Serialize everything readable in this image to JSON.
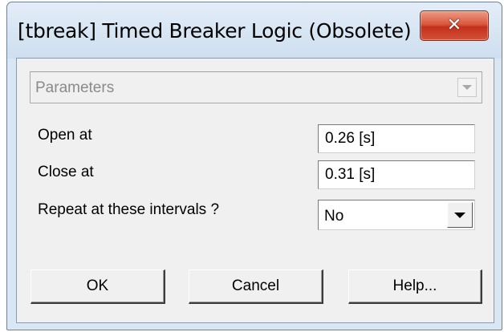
{
  "window": {
    "title": "[tbreak] Timed Breaker Logic (Obsolete)",
    "close_icon": "x-icon",
    "close_glyph": "✕"
  },
  "group_selector": {
    "value": "Parameters",
    "icon": "chevron-down-icon"
  },
  "params": {
    "open_at": {
      "label": "Open at",
      "value": "0.26 [s]"
    },
    "close_at": {
      "label": "Close at",
      "value": "0.31 [s]"
    },
    "repeat": {
      "label": "Repeat at these intervals ?",
      "value": "No",
      "icon": "dropdown-arrow-icon"
    }
  },
  "buttons": {
    "ok": "OK",
    "cancel": "Cancel",
    "help": "Help..."
  },
  "colors": {
    "title_bar": "#d7e5f3",
    "close_button": "#c4301a",
    "client_background": "#f0f0f0"
  }
}
